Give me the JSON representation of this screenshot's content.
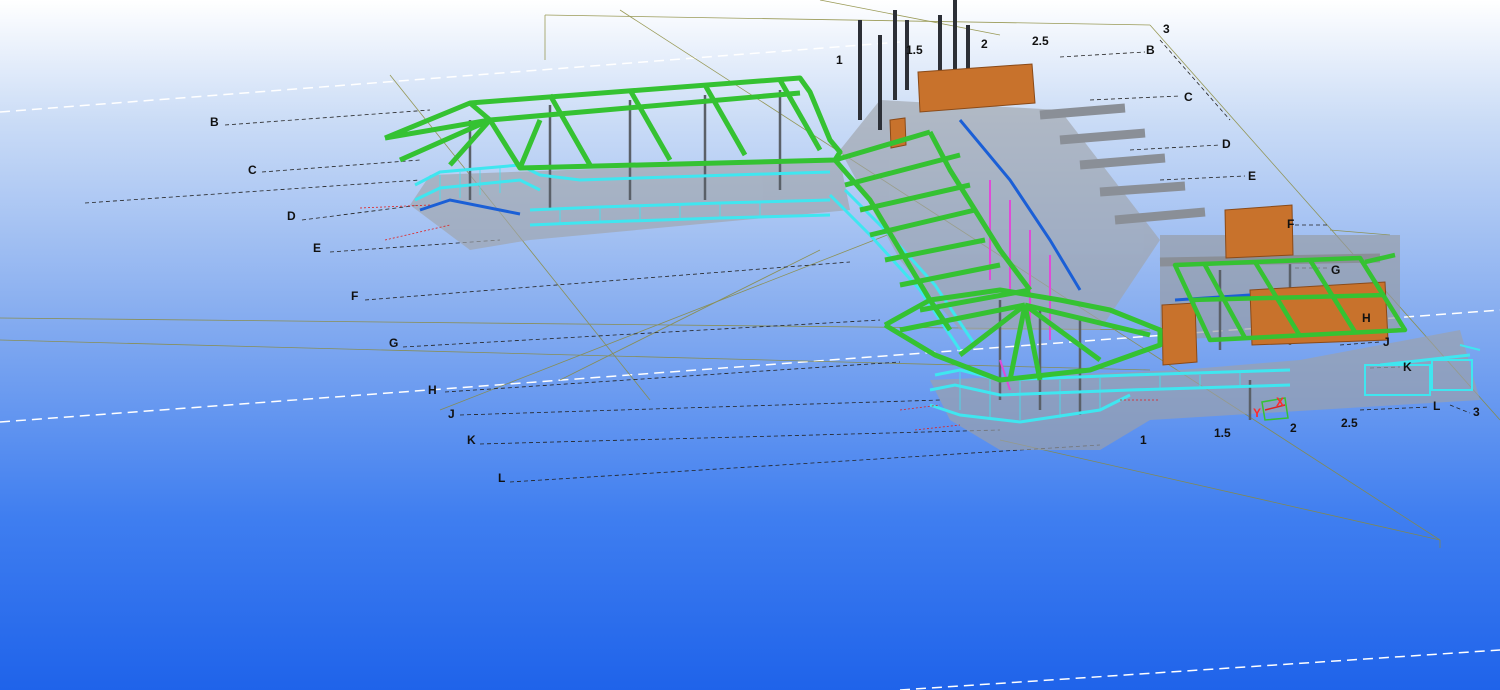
{
  "viewport": {
    "background_top": "#ffffff",
    "background_bottom": "#1f63ea"
  },
  "grid_lines": {
    "left_letters": [
      "B",
      "C",
      "D",
      "E",
      "F",
      "G",
      "H",
      "J",
      "K",
      "L"
    ],
    "right_letters": [
      "B",
      "C",
      "D",
      "E",
      "F",
      "G",
      "H",
      "J",
      "K",
      "L"
    ],
    "top_numbers": [
      "1",
      "1.5",
      "2",
      "2.5",
      "3"
    ],
    "bottom_numbers": [
      "1",
      "1.5",
      "2",
      "2.5",
      "3"
    ]
  },
  "axes": {
    "x_label": "X",
    "y_label": "Y",
    "x_color": "#ff2a2a",
    "y_color": "#ff2a2a"
  },
  "colors": {
    "steel_green": "#35c232",
    "handrail_cyan": "#3fe6f0",
    "member_gray": "#8a8f97",
    "slab_gray": "#a0a4aa",
    "column_dark": "#2c2f36",
    "plate_orange": "#c8722c",
    "beam_blue": "#1b5fd6",
    "brace_magenta": "#e04bd8"
  }
}
